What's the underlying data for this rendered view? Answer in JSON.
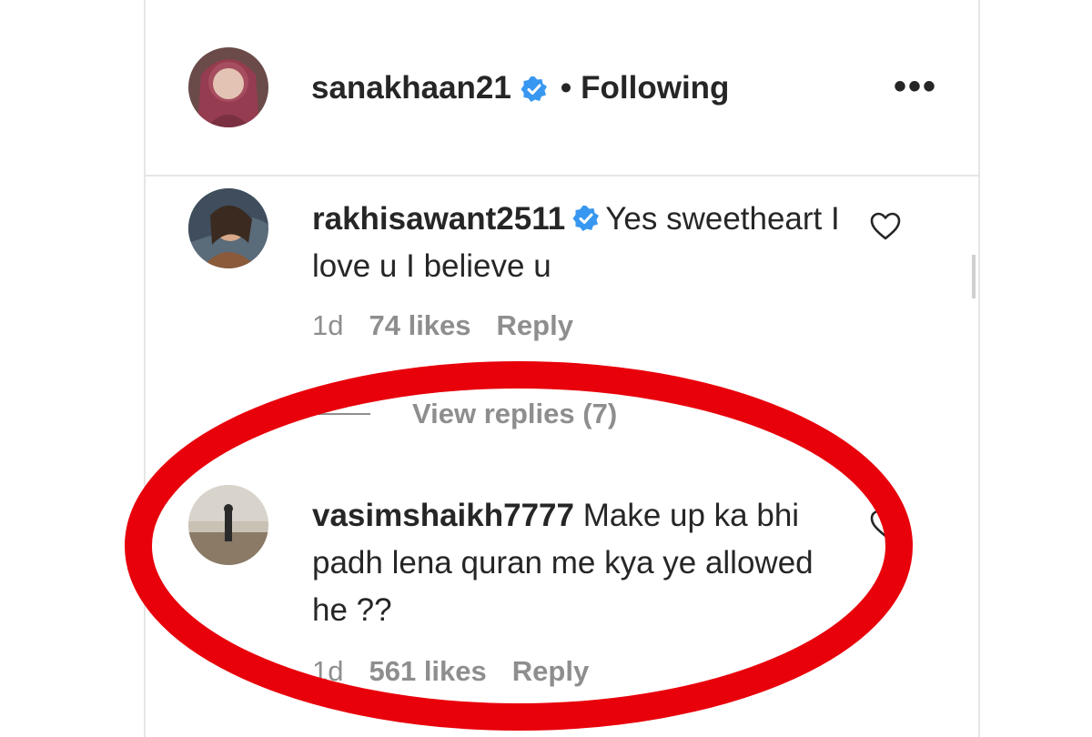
{
  "post": {
    "author": {
      "username": "sanakhaan21",
      "verified_icon": "verified-badge-icon",
      "separator": "•",
      "follow_status": "Following",
      "more_label": "•••"
    }
  },
  "comments": [
    {
      "username": "rakhisawant2511",
      "verified": true,
      "text": "Yes sweetheart I love u I believe u",
      "age": "1d",
      "likes": "74 likes",
      "reply_label": "Reply",
      "view_replies": "View replies (7)"
    },
    {
      "username": "vasimshaikh7777",
      "verified": false,
      "text": "Make up ka bhi padh lena quran me kya ye allowed he ??",
      "age": "1d",
      "likes": "561 likes",
      "reply_label": "Reply"
    }
  ],
  "colors": {
    "text": "#262626",
    "secondary": "#8e8e8e",
    "verified_blue": "#3897f0",
    "annotation_red": "#e8000b",
    "divider": "#e6e6e6"
  }
}
